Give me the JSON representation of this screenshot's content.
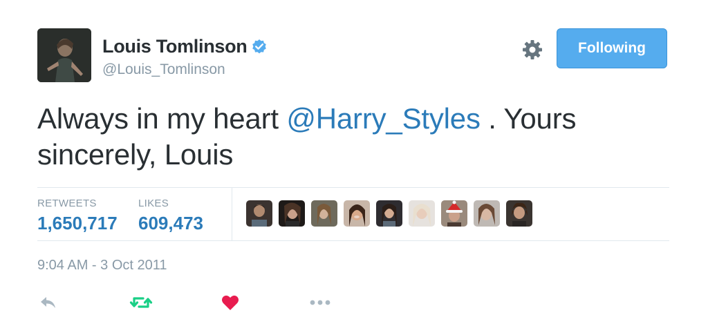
{
  "user": {
    "display_name": "Louis Tomlinson",
    "handle": "@Louis_Tomlinson",
    "verified": true
  },
  "follow_button": {
    "label": "Following"
  },
  "tweet": {
    "text_before": "Always in my heart ",
    "mention": "@Harry_Styles",
    "text_after": " . Yours sincerely, Louis"
  },
  "stats": {
    "retweets_label": "RETWEETS",
    "retweets_value": "1,650,717",
    "likes_label": "LIKES",
    "likes_value": "609,473"
  },
  "likers_count": 9,
  "timestamp": "9:04 AM - 3 Oct 2011",
  "actions": [
    "reply-icon",
    "retweet-icon",
    "heart-icon",
    "more-icon"
  ],
  "colors": {
    "accent": "#55acee",
    "link": "#2b7bb9",
    "retweet": "#19cf86",
    "like": "#e81c4f",
    "muted": "#8899a6"
  }
}
